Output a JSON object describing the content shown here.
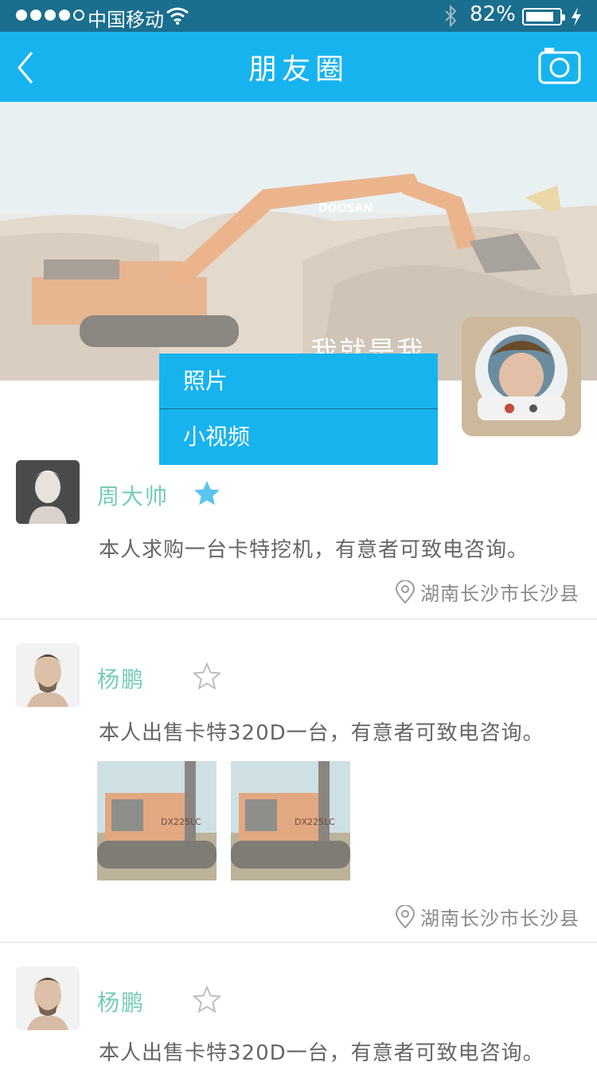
{
  "status_bar": {
    "carrier": "中国移动",
    "battery": "82%"
  },
  "nav": {
    "title": "朋友圈"
  },
  "cover": {
    "name": "我就是我"
  },
  "popup": {
    "items": [
      "照片",
      "小视频"
    ]
  },
  "posts": [
    {
      "name": "周大帅",
      "starred": true,
      "content": "本人求购一台卡特挖机，有意者可致电咨询。",
      "location": "湖南长沙市长沙县"
    },
    {
      "name": "杨鹏",
      "starred": false,
      "content": "本人出售卡特320D一台，有意者可致电咨询。",
      "location": "湖南长沙市长沙县"
    },
    {
      "name": "杨鹏",
      "starred": false,
      "content": "本人出售卡特320D一台，有意者可致电咨询。"
    }
  ],
  "colors": {
    "nav": "#17b3ef",
    "status": "#1a6e8e",
    "name": "#77ccb8",
    "star": "#5bc4ef"
  },
  "icons": [
    "back-chevron-icon",
    "camera-icon",
    "star-icon",
    "location-pin-icon"
  ]
}
